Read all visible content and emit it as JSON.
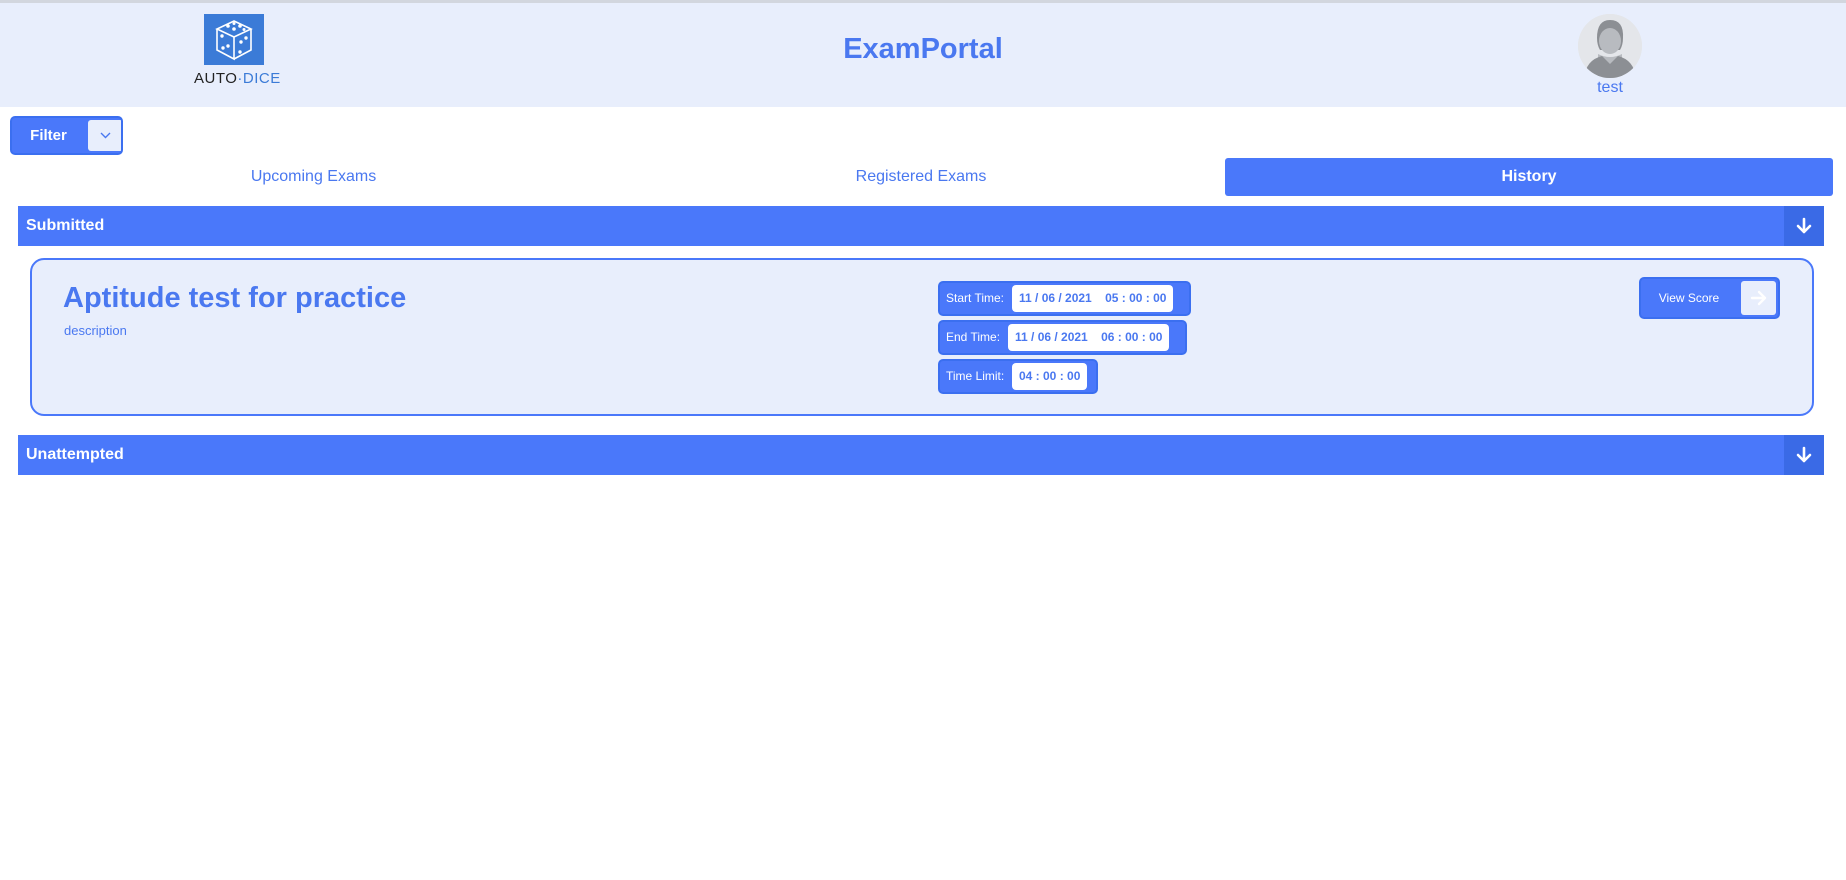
{
  "header": {
    "logo": {
      "text_main": "AUTO",
      "text_accent": "DICE"
    },
    "app_title": "ExamPortal",
    "user": {
      "name": "test"
    }
  },
  "filter": {
    "label": "Filter",
    "icon": "chevron-down-icon"
  },
  "tabs": [
    {
      "label": "Upcoming Exams",
      "active": false
    },
    {
      "label": "Registered Exams",
      "active": false
    },
    {
      "label": "History",
      "active": true
    }
  ],
  "sections": [
    {
      "title": "Submitted",
      "toggle_icon": "arrow-down-icon",
      "exams": [
        {
          "title": "Aptitude test for practice",
          "description": "description",
          "start_label": "Start Time:",
          "start_value": "11 / 06 / 2021    05 : 00 : 00",
          "end_label": "End Time:",
          "end_value": "11 / 06 / 2021    06 : 00 : 00",
          "limit_label": "Time Limit:",
          "limit_value": "04 : 00 : 00",
          "action_label": "View Score",
          "action_icon": "arrow-right-icon"
        }
      ]
    },
    {
      "title": "Unattempted",
      "toggle_icon": "arrow-down-icon",
      "exams": []
    }
  ],
  "colors": {
    "accent": "#4a78fa",
    "header_bg": "#e8eefc",
    "card_bg": "#e8eefc",
    "text_accent": "#4a78f0"
  }
}
